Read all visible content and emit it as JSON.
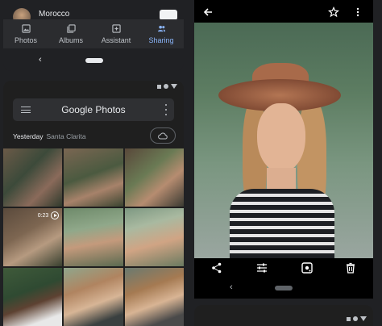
{
  "left_top": {
    "country_name": "Morocco",
    "nav": [
      {
        "label": "Photos",
        "icon": "photos-icon"
      },
      {
        "label": "Albums",
        "icon": "albums-icon"
      },
      {
        "label": "Assistant",
        "icon": "assistant-icon"
      },
      {
        "label": "Sharing",
        "icon": "sharing-icon",
        "active": true
      }
    ],
    "back_glyph": "‹"
  },
  "photos_app": {
    "title": "Google Photos",
    "date": "Yesterday",
    "location": "Santa Clarita",
    "video_duration": "0:23"
  },
  "viewer": {
    "back_glyph": "‹"
  },
  "colors": {
    "accent": "#8ab4f8",
    "background": "#202124",
    "surface": "#2b2c2f"
  }
}
